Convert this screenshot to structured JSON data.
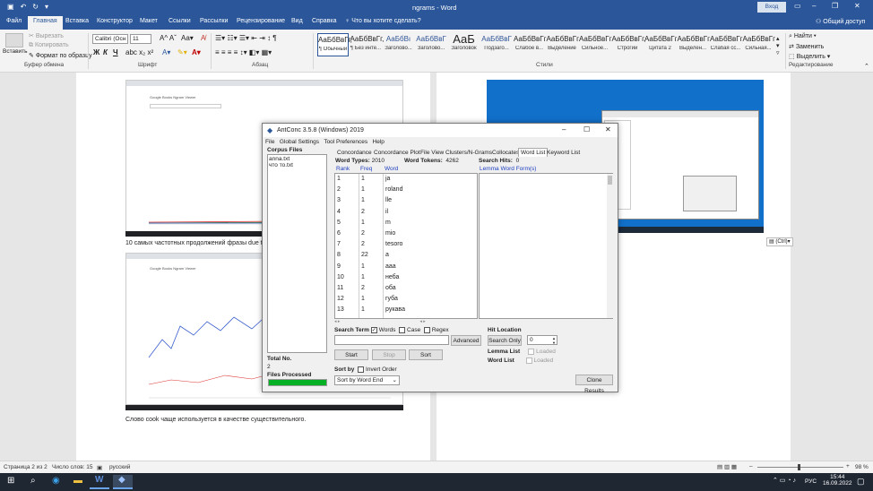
{
  "window": {
    "title": "ngrams  -  Word",
    "signin": "Вход",
    "share": "Общий доступ",
    "tell_me": "Что вы хотите сделать?"
  },
  "ribbon_tabs": [
    "Файл",
    "Главная",
    "Вставка",
    "Конструктор",
    "Макет",
    "Ссылки",
    "Рассылки",
    "Рецензирование",
    "Вид",
    "Справка"
  ],
  "ribbon": {
    "paste": "Вставить",
    "cut": "Вырезать",
    "copy": "Копировать",
    "format_painter": "Формат по образцу",
    "font_name": "Calibri (Осн",
    "font_size": "11",
    "groups": {
      "clipboard": "Буфер обмена",
      "font": "Шрифт",
      "paragraph": "Абзац",
      "styles": "Стили",
      "editing": "Редактирование"
    },
    "styles": [
      {
        "sample": "АаБбВвГг,",
        "name": "¶ Обычный"
      },
      {
        "sample": "АаБбВвГг,",
        "name": "¶ Без инте..."
      },
      {
        "sample": "АаБбВı",
        "name": "Заголово..."
      },
      {
        "sample": "АаБбВвГ",
        "name": "Заголово..."
      },
      {
        "sample": "АаБ",
        "name": "Заголовок"
      },
      {
        "sample": "АаБбВвГ",
        "name": "Подзаго..."
      },
      {
        "sample": "АаБбВвГг",
        "name": "Слабое в..."
      },
      {
        "sample": "АаБбВвГг",
        "name": "Выделение"
      },
      {
        "sample": "АаБбВвГг",
        "name": "Сильное..."
      },
      {
        "sample": "АаБбВвГг,",
        "name": "Строгий"
      },
      {
        "sample": "АаБбВвГг",
        "name": "Цитата 2"
      },
      {
        "sample": "АаБбВвГг",
        "name": "Выделен..."
      },
      {
        "sample": "АаБбВвГг",
        "name": "Слабая сс..."
      },
      {
        "sample": "АаБбВвГг",
        "name": "Сильная..."
      }
    ],
    "find": "Найти",
    "replace": "Заменить",
    "select": "Выделить"
  },
  "document": {
    "para1": "10 самых частотных продолжений фразы due to",
    "para2": "Слово cook чаще используется в качестве существительного.",
    "paste_options": "(Ctrl)",
    "shot_title": "Google Books Ngram Viewer"
  },
  "antconc": {
    "title": "AntConc 3.5.8 (Windows) 2019",
    "menu": [
      "File",
      "Global Settings",
      "Tool Preferences",
      "Help"
    ],
    "corpus_files_label": "Corpus Files",
    "corpus_files": [
      "anna.txt",
      "что то.txt"
    ],
    "tabs": [
      "Concordance",
      "Concordance Plot",
      "File View",
      "Clusters/N-Grams",
      "Collocates",
      "Word List",
      "Keyword List"
    ],
    "word_types_label": "Word Types:",
    "word_types": "2010",
    "word_tokens_label": "Word Tokens:",
    "word_tokens": "4262",
    "search_hits_label": "Search Hits:",
    "search_hits": "0",
    "col_rank": "Rank",
    "col_freq": "Freq",
    "col_word": "Word",
    "col_lemma": "Lemma Word Form(s)",
    "rows": [
      {
        "rank": "1",
        "freq": "1",
        "word": "ja"
      },
      {
        "rank": "2",
        "freq": "1",
        "word": "roland"
      },
      {
        "rank": "3",
        "freq": "1",
        "word": "lle"
      },
      {
        "rank": "4",
        "freq": "2",
        "word": "il"
      },
      {
        "rank": "5",
        "freq": "1",
        "word": "m"
      },
      {
        "rank": "6",
        "freq": "2",
        "word": "mio"
      },
      {
        "rank": "7",
        "freq": "2",
        "word": "tesoro"
      },
      {
        "rank": "8",
        "freq": "22",
        "word": "a"
      },
      {
        "rank": "9",
        "freq": "1",
        "word": "aaa"
      },
      {
        "rank": "10",
        "freq": "1",
        "word": "неба"
      },
      {
        "rank": "11",
        "freq": "2",
        "word": "оба"
      },
      {
        "rank": "12",
        "freq": "1",
        "word": "губа"
      },
      {
        "rank": "13",
        "freq": "1",
        "word": "рукава"
      }
    ],
    "search_term": "Search Term",
    "words": "Words",
    "case": "Case",
    "regex": "Regex",
    "advanced": "Advanced",
    "hit_location": "Hit Location",
    "search_only": "Search Only",
    "hit_value": "0",
    "start": "Start",
    "stop": "Stop",
    "sort": "Sort",
    "lemma_list": "Lemma List",
    "word_list": "Word List",
    "loaded": "Loaded",
    "sort_by": "Sort by",
    "invert_order": "Invert Order",
    "sort_option": "Sort by Word End",
    "total_no_label": "Total No.",
    "total_no": "2",
    "files_processed": "Files Processed",
    "progress": 1.0,
    "clone_results": "Clone Results"
  },
  "status": {
    "page": "Страница 2 из 2",
    "words": "Число слов: 15",
    "lang": "русский",
    "zoom": "98 %"
  },
  "taskbar": {
    "lang": "РУС",
    "time": "15:44",
    "date": "16.09.2022"
  },
  "colors": {
    "word_blue": "#2b579a",
    "progress_green": "#06b025"
  }
}
